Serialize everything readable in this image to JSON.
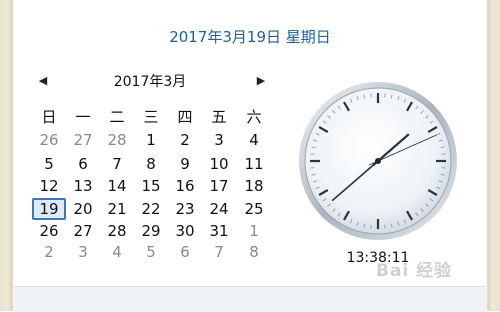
{
  "header": {
    "full_date": "2017年3月19日 星期日"
  },
  "calendar": {
    "prev_icon": "triangle-left-icon",
    "next_icon": "triangle-right-icon",
    "month_title": "2017年3月",
    "weekdays": [
      "日",
      "一",
      "二",
      "三",
      "四",
      "五",
      "六"
    ],
    "weeks": [
      [
        {
          "d": "26",
          "other": true
        },
        {
          "d": "27",
          "other": true
        },
        {
          "d": "28",
          "other": true
        },
        {
          "d": "1"
        },
        {
          "d": "2"
        },
        {
          "d": "3"
        },
        {
          "d": "4"
        }
      ],
      [
        {
          "d": "5"
        },
        {
          "d": "6"
        },
        {
          "d": "7"
        },
        {
          "d": "8"
        },
        {
          "d": "9"
        },
        {
          "d": "10"
        },
        {
          "d": "11"
        }
      ],
      [
        {
          "d": "12"
        },
        {
          "d": "13"
        },
        {
          "d": "14"
        },
        {
          "d": "15"
        },
        {
          "d": "16"
        },
        {
          "d": "17"
        },
        {
          "d": "18"
        }
      ],
      [
        {
          "d": "19",
          "today": true
        },
        {
          "d": "20"
        },
        {
          "d": "21"
        },
        {
          "d": "22"
        },
        {
          "d": "23"
        },
        {
          "d": "24"
        },
        {
          "d": "25"
        }
      ],
      [
        {
          "d": "26"
        },
        {
          "d": "27"
        },
        {
          "d": "28"
        },
        {
          "d": "29"
        },
        {
          "d": "30"
        },
        {
          "d": "31"
        },
        {
          "d": "1",
          "other": true
        }
      ],
      [
        {
          "d": "2",
          "other": true
        },
        {
          "d": "3",
          "other": true
        },
        {
          "d": "4",
          "other": true
        },
        {
          "d": "5",
          "other": true
        },
        {
          "d": "6",
          "other": true
        },
        {
          "d": "7",
          "other": true
        },
        {
          "d": "8",
          "other": true
        }
      ]
    ]
  },
  "clock": {
    "time": "13:38:11",
    "hour": 13,
    "minute": 38,
    "second": 11
  },
  "watermark": "Bai 经验",
  "colors": {
    "accent": "#1f5fa3",
    "today_border": "#3f76b8"
  }
}
